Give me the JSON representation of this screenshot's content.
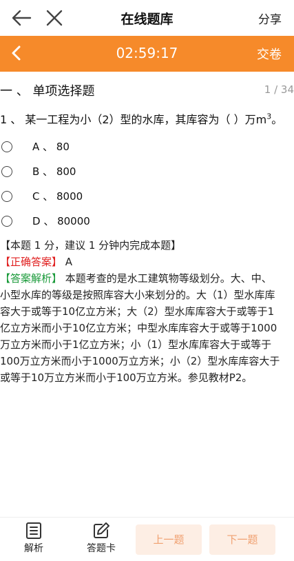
{
  "header": {
    "title": "在线题库",
    "share_label": "分享"
  },
  "timer_bar": {
    "time": "02:59:17",
    "submit_label": "交卷"
  },
  "section": {
    "title": "一 、 单项选择题",
    "page_indicator": "1 / 34"
  },
  "question": {
    "text": "1 、 某一工程为小（2）型的水库，其库容为（    ）万m",
    "superscript": "3",
    "suffix": "。"
  },
  "options": [
    {
      "letter": "A",
      "text": "A 、 80"
    },
    {
      "letter": "B",
      "text": "B 、 800"
    },
    {
      "letter": "C",
      "text": "C 、 8000"
    },
    {
      "letter": "D",
      "text": "D 、 80000"
    }
  ],
  "info": {
    "score_note": "【本题 1 分，建议 1 分钟内完成本题】",
    "correct_label": "【正确答案】",
    "correct_value": " A",
    "analysis_label": "【答案解析】",
    "analysis_lines": [
      " 本题考查的是水工建筑物等级划分。大、中、",
      "小型水库的等级是按照库容大小来划分的。大（1）型水库库",
      "容大于或等于10亿立方米；大（2）型水库库容大于或等于1",
      "亿立方米而小于10亿立方米；中型水库库容大于或等于1000",
      "万立方米而小于1亿立方米；小（1）型水库库容大于或等于",
      "100万立方米而小于1000万立方米；小（2）型水库库容大于",
      "或等于10万立方米而小于100万立方米。参见教材P2。"
    ]
  },
  "bottom": {
    "analysis_label": "解析",
    "answer_card_label": "答题卡",
    "prev_label": "上一题",
    "next_label": "下一题"
  },
  "colors": {
    "accent": "#f68a2a",
    "correct": "#e02020",
    "analysis": "#1a9a3a"
  }
}
